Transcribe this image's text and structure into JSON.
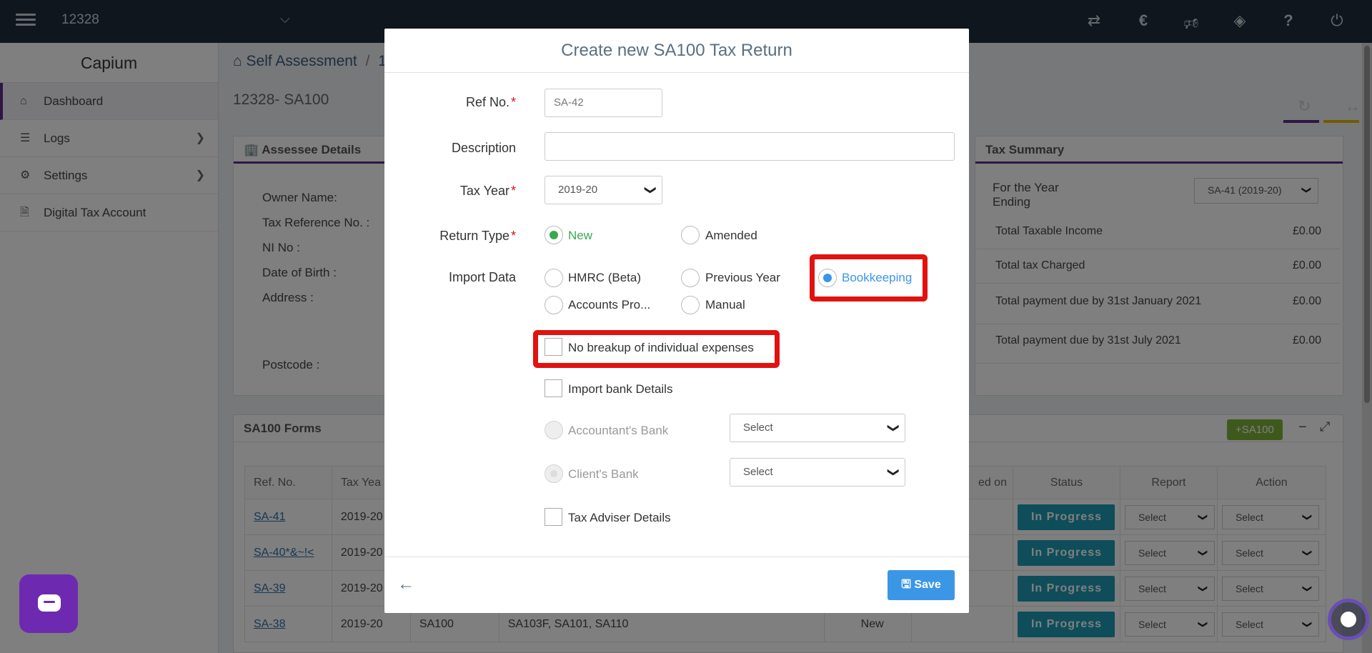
{
  "topbar": {
    "client": "12328",
    "icons": [
      "transfer-icon",
      "capium-c-icon",
      "megaphone-icon",
      "ticket-icon",
      "help-icon",
      "power-icon"
    ]
  },
  "sidebar": {
    "brand": "Capium",
    "items": [
      {
        "label": "Dashboard",
        "icon": "home-icon"
      },
      {
        "label": "Logs",
        "icon": "list-icon"
      },
      {
        "label": "Settings",
        "icon": "gear-icon"
      },
      {
        "label": "Digital Tax Account",
        "icon": "document-icon"
      }
    ]
  },
  "content": {
    "breadcrumb": {
      "root": "Self Assessment",
      "sep": "/",
      "next": "1"
    },
    "page_title": "12328- SA100",
    "assessee": {
      "title": "Assessee Details",
      "labels": [
        "Owner Name:",
        "Tax Reference No. :",
        "NI No :",
        "Date of Birth :",
        "Address :",
        "Postcode :"
      ]
    },
    "summary": {
      "title": "Tax Summary",
      "year_label_1": "For the Year",
      "year_label_2": "Ending",
      "year_select": "SA-41 (2019-20)",
      "rows": [
        {
          "k": "Total Taxable Income",
          "v": "£0.00"
        },
        {
          "k": "Total tax Charged",
          "v": "£0.00"
        },
        {
          "k": "Total payment due by 31st January 2021",
          "v": "£0.00"
        },
        {
          "k": "Total payment due by 31st July 2021",
          "v": "£0.00"
        }
      ]
    },
    "forms": {
      "title": "SA100 Forms",
      "add_label": "+SA100",
      "headers": [
        "Ref. No.",
        "Tax Yea",
        "",
        "",
        "",
        "ed on",
        "Status",
        "Report",
        "Action"
      ],
      "rows": [
        {
          "ref": "SA-41",
          "year": "2019-20",
          "form": "",
          "sup": "",
          "kind": "",
          "status": "In Progress",
          "report": "Select",
          "action": "Select"
        },
        {
          "ref": "SA-40*&~!<",
          "year": "2019-20",
          "form": "",
          "sup": "",
          "kind": "",
          "status": "In Progress",
          "report": "Select",
          "action": "Select"
        },
        {
          "ref": "SA-39",
          "year": "2019-20",
          "form": "",
          "sup": "",
          "kind": "",
          "status": "In Progress",
          "report": "Select",
          "action": "Select"
        },
        {
          "ref": "SA-38",
          "year": "2019-20",
          "form": "SA100",
          "sup": "SA103F, SA101, SA110",
          "kind": "New",
          "status": "In Progress",
          "report": "Select",
          "action": "Select"
        }
      ]
    }
  },
  "modal": {
    "title": "Create new SA100 Tax Return",
    "ref_label": "Ref No.",
    "ref_value": "SA-42",
    "desc_label": "Description",
    "desc_value": "",
    "year_label": "Tax Year",
    "year_value": "2019-20",
    "return_type_label": "Return Type",
    "return_new": "New",
    "return_amended": "Amended",
    "import_label": "Import Data",
    "import_hmrc": "HMRC (Beta)",
    "import_prev": "Previous Year",
    "import_book": "Bookkeeping",
    "import_accounts": "Accounts Pro...",
    "import_manual": "Manual",
    "chk_no_breakup": "No breakup of individual expenses",
    "chk_bank": "Import bank Details",
    "acct_bank": "Accountant's Bank",
    "client_bank": "Client's Bank",
    "select_placeholder": "Select",
    "chk_adviser": "Tax Adviser Details",
    "save": "Save",
    "required_mark": "*"
  }
}
